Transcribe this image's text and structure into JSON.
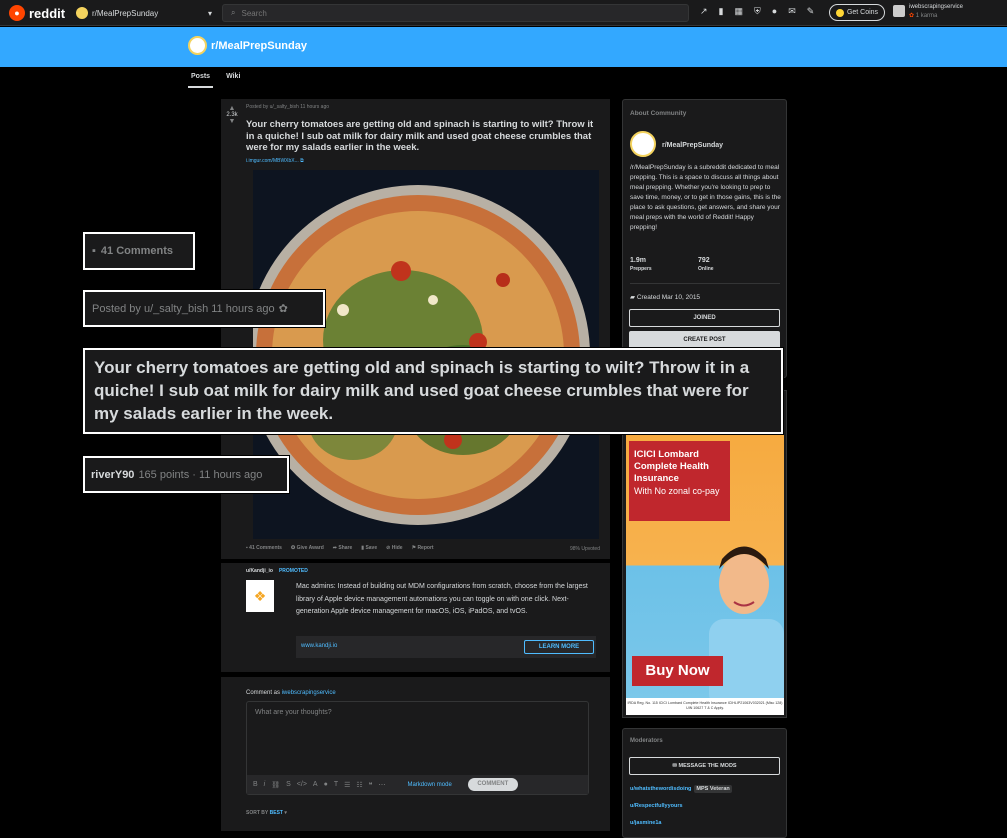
{
  "topbar": {
    "logo_text": "reddit",
    "subreddit": "r/MealPrepSunday",
    "search_placeholder": "Search",
    "coins_label": "Get Coins",
    "username": "iwebscrapingservice",
    "karma": "1 karma"
  },
  "banner": {
    "title": "r/MealPrepSunday"
  },
  "tabs": [
    "Posts",
    "Wiki"
  ],
  "post": {
    "score": "2.3k",
    "meta": "Posted by u/_salty_bish 11 hours ago",
    "title": "Your cherry tomatoes are getting old and spinach is starting to wilt? Throw it in a quiche! I sub oat milk for dairy milk and used goat cheese crumbles that were for my salads earlier in the week.",
    "link": "i.imgur.com/MBWXbX...",
    "actions": [
      "41 Comments",
      "Give Award",
      "Share",
      "Save",
      "Hide",
      "Report"
    ],
    "upvoted": "98% Upvoted"
  },
  "promo": {
    "author": "u/Kandji_io",
    "tag": "PROMOTED",
    "text": "Mac admins: Instead of building out MDM configurations from scratch, choose from the largest library of Apple device management automations you can toggle on with one click. Next-generation Apple device management for macOS, iOS, iPadOS, and tvOS.",
    "url": "www.kandji.io",
    "button": "LEARN MORE"
  },
  "comment": {
    "as_label": "Comment as",
    "as_user": "iwebscrapingservice",
    "placeholder": "What are your thoughts?",
    "markdown": "Markdown mode",
    "button": "COMMENT",
    "sort_label": "SORT BY",
    "sort_value": "BEST"
  },
  "about": {
    "heading": "About Community",
    "name": "r/MealPrepSunday",
    "description": "/r/MealPrepSunday is a subreddit dedicated to meal prepping. This is a space to discuss all things about meal prepping. Whether you're looking to prep to save time, money, or to get in those gains, this is the place to ask questions, get answers, and share your meal preps with the world of Reddit! Happy prepping!",
    "members": "1.9m",
    "members_label": "Preppers",
    "online": "792",
    "online_label": "Online",
    "created": "Created Mar 10, 2015",
    "joined_button": "JOINED",
    "create_post_button": "CREATE POST"
  },
  "ad": {
    "title": "ICICI Lombard Complete Health Insurance",
    "sub": "With No zonal co-pay",
    "buy": "Buy Now",
    "reg": "IRDA Reg. No. 115 ICICI Lombard Complete Health Insurance ICIHLIP21063V032021 (Misc 128) UIN 10627 T & C Apply."
  },
  "moderators": {
    "heading": "Moderators",
    "button": "MESSAGE THE MODS",
    "list": [
      "u/whatsthewordisdoing",
      "u/Respectfullyyours",
      "u/jasmine1a"
    ],
    "flair": "MPS Veteran"
  },
  "callouts": {
    "comments": "41 Comments",
    "posted_by": "Posted by u/_salty_bish 11 hours ago",
    "title": "Your cherry tomatoes are getting old and spinach is starting to wilt? Throw it in a quiche! I sub oat milk for dairy milk and used goat cheese crumbles that were for my salads earlier in the week.",
    "user": "riverY90",
    "points": "165 points · 11 hours ago"
  }
}
